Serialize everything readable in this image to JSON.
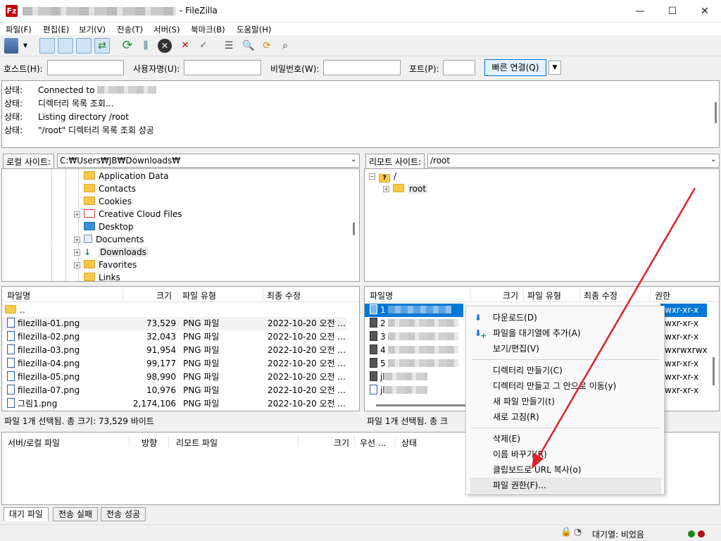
{
  "window": {
    "title": "- FileZilla",
    "controls": {
      "minimize": "—",
      "maximize": "☐",
      "close": "✕"
    }
  },
  "menu": [
    "파일(F)",
    "편집(E)",
    "보기(V)",
    "전송(T)",
    "서버(S)",
    "북마크(B)",
    "도움말(H)"
  ],
  "quickconnect": {
    "host_label": "호스트(H):",
    "user_label": "사용자명(U):",
    "pass_label": "비밀번호(W):",
    "port_label": "포트(P):",
    "connect_label": "빠른 연결(Q)"
  },
  "log": [
    {
      "k": "상태:",
      "v": "Connected to"
    },
    {
      "k": "상태:",
      "v": "디렉터리 목록 조회..."
    },
    {
      "k": "상태:",
      "v": "Listing directory /root"
    },
    {
      "k": "상태:",
      "v": "\"/root\" 디렉터리 목록 조회 성공"
    }
  ],
  "local": {
    "label": "로컬 사이트:",
    "path": "C:₩Users₩JB₩Downloads₩",
    "tree": [
      "Application Data",
      "Contacts",
      "Cookies",
      "Creative Cloud Files",
      "Desktop",
      "Documents",
      "Downloads",
      "Favorites",
      "Links"
    ],
    "headers": {
      "name": "파일명",
      "size": "크기",
      "type": "파일 유형",
      "modified": "최종 수정"
    },
    "files": [
      {
        "name": "..",
        "size": "",
        "type": "",
        "modified": ""
      },
      {
        "name": "filezilla-01.png",
        "size": "73,529",
        "type": "PNG 파일",
        "modified": "2022-10-20 오전 ..."
      },
      {
        "name": "filezilla-02.png",
        "size": "32,043",
        "type": "PNG 파일",
        "modified": "2022-10-20 오전 ..."
      },
      {
        "name": "filezilla-03.png",
        "size": "91,954",
        "type": "PNG 파일",
        "modified": "2022-10-20 오전 ..."
      },
      {
        "name": "filezilla-04.png",
        "size": "99,177",
        "type": "PNG 파일",
        "modified": "2022-10-20 오전 ..."
      },
      {
        "name": "filezilla-05.png",
        "size": "98,990",
        "type": "PNG 파일",
        "modified": "2022-10-20 오전 ..."
      },
      {
        "name": "filezilla-07.png",
        "size": "10,976",
        "type": "PNG 파일",
        "modified": "2022-10-20 오전 ..."
      },
      {
        "name": "그림1.png",
        "size": "2,174,106",
        "type": "PNG 파일",
        "modified": "2022-10-20 오전 ..."
      }
    ],
    "status": "파일 1개 선택됨. 총 크기: 73,529 바이트"
  },
  "remote": {
    "label": "리모트 사이트:",
    "path": "/root",
    "tree": [
      "/",
      "root"
    ],
    "headers": {
      "name": "파일명",
      "size": "크기",
      "type": "파일 유형",
      "modified": "최종 수정",
      "perm": "권한"
    },
    "files": [
      {
        "name": "1",
        "perm": "wxr-xr-x"
      },
      {
        "name": "2",
        "perm": "wxr-xr-x"
      },
      {
        "name": "3",
        "perm": "wxr-xr-x"
      },
      {
        "name": "4",
        "perm": "wxrwxrwx"
      },
      {
        "name": "5",
        "perm": "wxr-xr-x"
      },
      {
        "name": "jl",
        "perm": "wxr-xr-x"
      },
      {
        "name": "jl",
        "perm": "wxr-xr-x"
      }
    ],
    "status": "파일 1개 선택됨. 총 크"
  },
  "queue": {
    "headers": {
      "server": "서버/로컬 파일",
      "direction": "방향",
      "remote": "리모트 파일",
      "size": "크기",
      "priority": "우선 ...",
      "status": "상태"
    },
    "tabs": [
      "대기 파일",
      "전송 실패",
      "전송 성공"
    ]
  },
  "statusbar": {
    "queue_text": "대기열: 비었음"
  },
  "context_menu": {
    "group1": [
      "다운로드(D)",
      "파일을 대기열에 추가(A)",
      "보기/편집(V)"
    ],
    "group2": [
      "디렉터리 만들기(C)",
      "디렉터리 만들고 그 안으로 이동(y)",
      "새 파일 만들기(t)",
      "새로 고침(R)"
    ],
    "group3": [
      "삭제(E)",
      "이름 바꾸기(R)",
      "클립보드로 URL 복사(o)",
      "파일 권한(F)..."
    ]
  },
  "colors": {
    "accent": "#0078d7",
    "arrow": "#e0202a",
    "selection": "#0078d7"
  }
}
